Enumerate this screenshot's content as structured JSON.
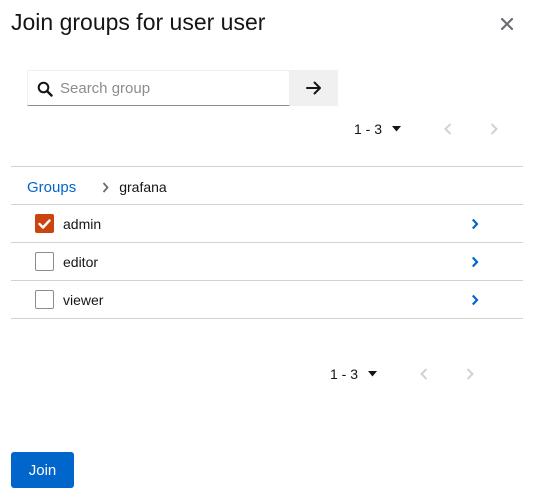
{
  "modal": {
    "title": "Join groups for user user",
    "close_icon": "close-icon"
  },
  "search": {
    "placeholder": "Search group",
    "value": "",
    "search_icon": "search-icon",
    "submit_icon": "arrow-right-icon"
  },
  "pagination_top": {
    "range": "1 - 3",
    "prev_enabled": false,
    "next_enabled": false
  },
  "pagination_bottom": {
    "range": "1 - 3",
    "prev_enabled": false,
    "next_enabled": false
  },
  "breadcrumb": {
    "root": "Groups",
    "current": "grafana"
  },
  "groups": [
    {
      "name": "admin",
      "checked": true
    },
    {
      "name": "editor",
      "checked": false
    },
    {
      "name": "viewer",
      "checked": false
    }
  ],
  "footer": {
    "join_label": "Join"
  },
  "colors": {
    "primary": "#0066cc",
    "checked": "#c9440f",
    "link": "#0066cc"
  }
}
